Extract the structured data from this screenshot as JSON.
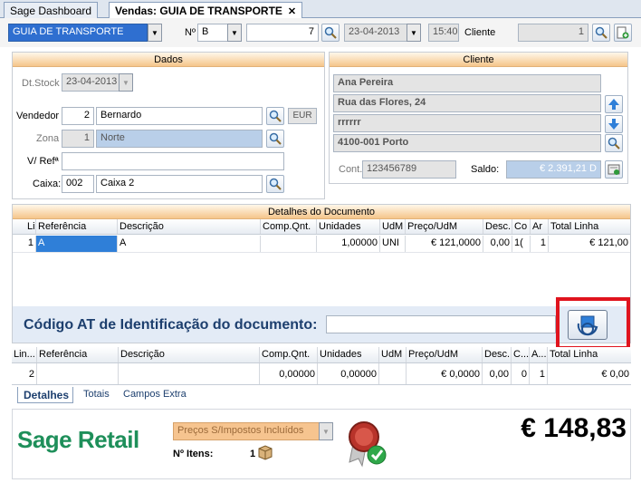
{
  "tabs": [
    {
      "label": "Sage Dashboard",
      "active": false
    },
    {
      "label": "Vendas: GUIA DE TRANSPORTE",
      "active": true
    }
  ],
  "tab_close": "✕",
  "toolbar": {
    "doc_type": "GUIA DE TRANSPORTE",
    "numero_label": "Nº",
    "serie": "B",
    "numero": "7",
    "data": "23-04-2013",
    "hora": "15:40",
    "cliente_label": "Cliente",
    "cliente_num": "1"
  },
  "dados": {
    "title": "Dados",
    "dtstock_label": "Dt.Stock",
    "dtstock": "23-04-2013",
    "vendedor_label": "Vendedor",
    "vendedor_num": "2",
    "vendedor_nome": "Bernardo",
    "moeda": "EUR",
    "zona_label": "Zona",
    "zona_num": "1",
    "zona_nome": "Norte",
    "vref_label": "V/ Refª",
    "vref": "",
    "caixa_label": "Caixa:",
    "caixa_num": "002",
    "caixa_nome": "Caixa 2"
  },
  "cliente": {
    "title": "Cliente",
    "nome": "Ana Pereira",
    "morada": "Rua das Flores, 24",
    "localidade": "rrrrrr",
    "codpostal": "4100-001 Porto",
    "cont_label": "Cont.:",
    "contribuinte": "123456789",
    "saldo_label": "Saldo:",
    "saldo": "€ 2.391,21 D"
  },
  "detalhes": {
    "title": "Detalhes do Documento",
    "columns": [
      "Li",
      "Referência",
      "Descrição",
      "Comp.Qnt.",
      "Unidades",
      "UdM",
      "Preço/UdM",
      "Desc.",
      "Co",
      "Ar",
      "Total Linha"
    ],
    "rows": [
      [
        "1",
        "A",
        "A",
        "",
        "1,00000",
        "UNI",
        "€ 121,0000",
        "0,00",
        "1(",
        "1",
        "€ 121,00"
      ]
    ]
  },
  "at_code": {
    "label": "Código AT de Identificação do documento:",
    "value": ""
  },
  "grid2": {
    "columns": [
      "Lin...",
      "Referência",
      "Descrição",
      "Comp.Qnt.",
      "Unidades",
      "UdM",
      "Preço/UdM",
      "Desc.",
      "C...",
      "A...",
      "Total Linha"
    ],
    "rows": [
      [
        "2",
        "",
        "",
        "0,00000",
        "0,00000",
        "",
        "€ 0,0000",
        "0,00",
        "0",
        "1",
        "€ 0,00"
      ]
    ]
  },
  "bottom_tabs": [
    "Detalhes",
    "Totais",
    "Campos Extra"
  ],
  "footer": {
    "brand": "Sage Retail",
    "precos": "Preços S/Impostos Incluídos",
    "itens_label": "Nº Itens:",
    "itens": "1",
    "total": "€ 148,83"
  },
  "colors": {
    "brand_green": "#1e8f5a",
    "highlight_red": "#e0141e",
    "panel_orange": "#f5c58a"
  }
}
